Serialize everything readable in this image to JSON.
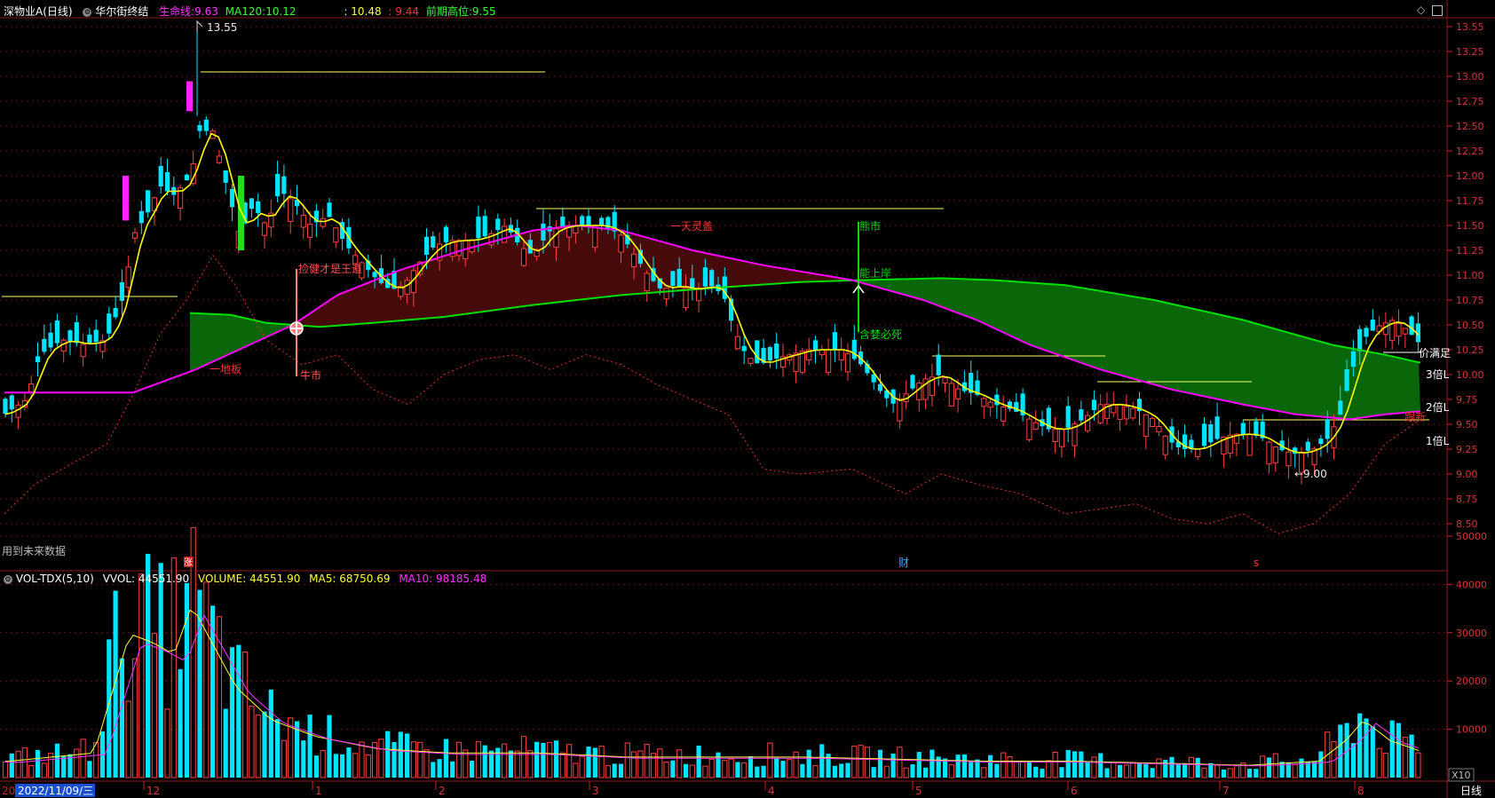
{
  "header": {
    "stock": "深物业A(日线)",
    "indicator": "华尔街终结",
    "lifeline_label": "生命线:",
    "lifeline_value": "9.63",
    "ma120_label": "MA120:",
    "ma120_value": "10.12",
    "v1": ": 10.48",
    "v2": ": 9.44",
    "prev_high_label": "前期高位:",
    "prev_high_value": "9.55"
  },
  "vol_header": {
    "name": "VOL-TDX(5,10)",
    "vvol": "VVOL: 44551.90",
    "volume": "VOLUME: 44551.90",
    "ma5": "MA5: 68750.69",
    "ma10": "MA10: 98185.48"
  },
  "price_axis": [
    "13.55",
    "13.25",
    "13.00",
    "12.75",
    "12.50",
    "12.25",
    "12.00",
    "11.75",
    "11.50",
    "11.25",
    "11.00",
    "10.75",
    "10.50",
    "10.25",
    "10.00",
    "9.75",
    "9.50",
    "9.25",
    "9.00",
    "8.75",
    "8.50"
  ],
  "volume_axis": [
    "50000",
    "40000",
    "30000",
    "20000",
    "10000"
  ],
  "time_axis": {
    "date": "2022/11/09/三",
    "months": [
      "12",
      "1",
      "2",
      "3",
      "4",
      "5",
      "6",
      "7",
      "8"
    ]
  },
  "annotations": {
    "high": "13.55",
    "low": "←9.00",
    "label_bottom_left": "用到未来数据",
    "yidiban": "一地板",
    "niushi": "牛市",
    "jiaocai": "捡健才是王道",
    "tianlinggai": "一天灵盖",
    "xiongshi": "熊市",
    "nengshangan": "能上岸",
    "hanniusi": "含婪必死",
    "bei1": "1倍L",
    "bei2": "2倍L",
    "bei3": "3倍L",
    "jiamanzu": "价满足",
    "zhangfu": "跟新",
    "event_zhang": "涨",
    "event_cai": "财",
    "event_s": "s",
    "x10": "X10",
    "period": "日线"
  },
  "colors": {
    "up": "#ff4040",
    "down": "#00e5ff",
    "ma_yellow": "#ffff00",
    "ma_magenta": "#ff00ff",
    "ma_green": "#00e000",
    "grid": "#7a1010"
  }
}
